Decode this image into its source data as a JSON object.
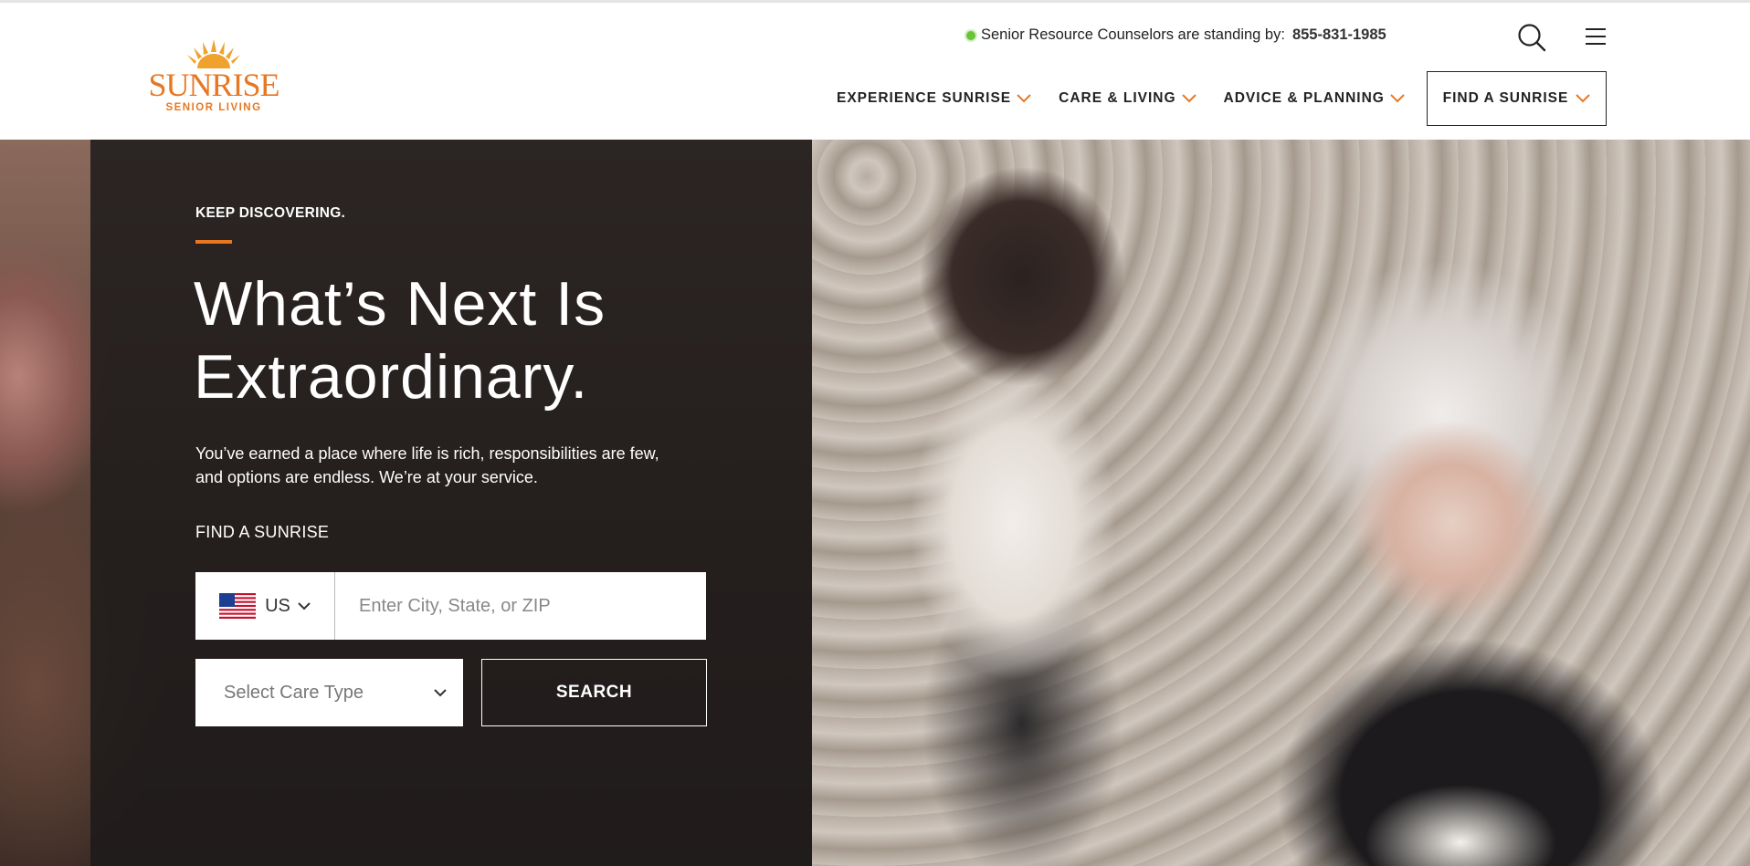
{
  "brand": {
    "name": "SUNRISE",
    "tagline": "SENIOR LIVING",
    "color": "#e87722",
    "sun_color": "#f0a22e"
  },
  "topbar": {
    "status_text": "Senior Resource Counselors are standing by:",
    "phone": "855-831-1985",
    "status_color": "#6dc23b"
  },
  "icons": {
    "search": "search-icon",
    "menu": "hamburger-menu-icon",
    "chevron": "chevron-down-icon",
    "flag": "us-flag-icon"
  },
  "nav": {
    "items": [
      {
        "label": "EXPERIENCE SUNRISE"
      },
      {
        "label": "CARE & LIVING"
      },
      {
        "label": "ADVICE & PLANNING"
      }
    ],
    "cta_label": "FIND A SUNRISE"
  },
  "hero": {
    "eyebrow": "KEEP DISCOVERING.",
    "headline_line1": "What’s Next Is",
    "headline_line2": "Extraordinary.",
    "subcopy": "You’ve earned a place where life is rich, responsibilities are few, and options are endless. We’re at your service.",
    "find_label": "FIND A SUNRISE",
    "country_code": "US",
    "location_placeholder": "Enter City, State, or ZIP",
    "care_type_value": "Select Care Type",
    "search_label": "SEARCH"
  }
}
